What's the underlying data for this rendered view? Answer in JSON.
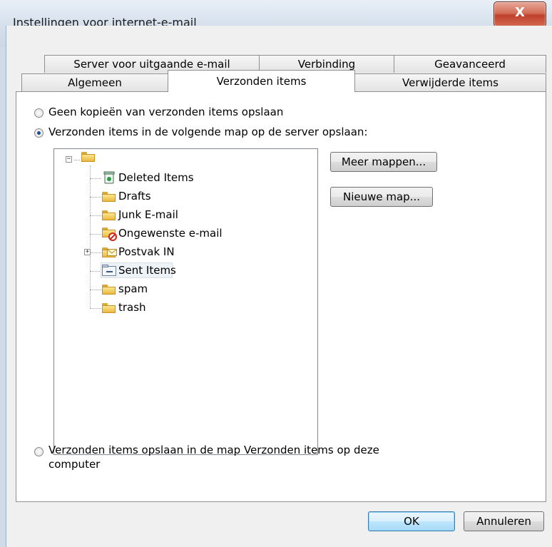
{
  "window": {
    "title": "Instellingen voor internet-e-mail",
    "close_glyph": "X"
  },
  "tabs_back": [
    "Server voor uitgaande e-mail",
    "Verbinding",
    "Geavanceerd"
  ],
  "tabs_front": [
    "Algemeen",
    "Verzonden items",
    "Verwijderde items"
  ],
  "options": {
    "no_copies": "Geen kopieën van verzonden items opslaan",
    "server_folder": "Verzonden items in de volgende map op de server opslaan:",
    "local_line1": "Verzonden items opslaan in de map Verzonden items op deze",
    "local_line2": "computer",
    "selected": "server_folder"
  },
  "tree": {
    "items": [
      {
        "label": "Deleted Items",
        "icon": "recycle-folder-icon"
      },
      {
        "label": "Drafts",
        "icon": "folder-icon"
      },
      {
        "label": "Junk E-mail",
        "icon": "folder-icon"
      },
      {
        "label": "Ongewenste e-mail",
        "icon": "junk-folder-icon"
      },
      {
        "label": "Postvak IN",
        "icon": "inbox-folder-icon",
        "expandable": true
      },
      {
        "label": "Sent Items",
        "icon": "sent-folder-icon",
        "selected": true
      },
      {
        "label": "spam",
        "icon": "folder-icon"
      },
      {
        "label": "trash",
        "icon": "folder-icon"
      }
    ]
  },
  "buttons": {
    "more_folders": "Meer mappen...",
    "new_folder": "Nieuwe map...",
    "ok": "OK",
    "cancel": "Annuleren"
  },
  "colors": {
    "close_button": "#c7432c",
    "accent": "#3c7fb1"
  }
}
